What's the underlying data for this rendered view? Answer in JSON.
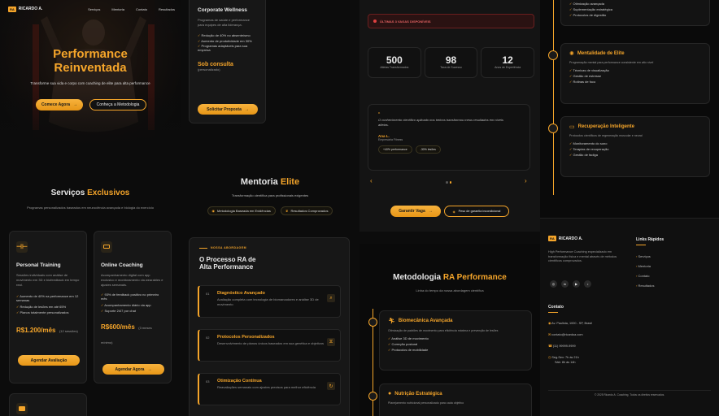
{
  "nav": {
    "logo_badge": "RA",
    "brand": "RICARDO A.",
    "items": [
      "Serviços",
      "Mentoria",
      "Contato",
      "Resultados"
    ]
  },
  "hero": {
    "title_line1": "Performance",
    "title_line2": "Reinventada",
    "subtitle": "Transforme sua vida e corpo com coaching de elite para alta performance",
    "cta_primary": "Comece Agora",
    "cta_secondary": "Conheça a Metodologia"
  },
  "services": {
    "title_a": "Serviços",
    "title_b": "Exclusivos",
    "subtitle": "Programas personalizados baseados em neurociência avançada e biologia do exercício",
    "cards": [
      {
        "title": "Personal Training",
        "desc": "Sessões individuais com análise de movimento em 3D e biofeedback em tempo real.",
        "features": [
          "Aumento de 40% na performance em 12 semanas",
          "Redução de lesões em até 65%",
          "Planos totalmente personalizados"
        ],
        "price": "R$1.200/mês",
        "price_note": "(12 sessões)",
        "cta": "Agendar Avaliação"
      },
      {
        "title": "Online Coaching",
        "desc": "Acompanhamento digital com app exclusivo e monitoramento via wearables e ajustes semanais.",
        "features": [
          "93% de feedback positivo no primeiro mês",
          "Acompanhamento diário via app",
          "Suporte 24/7 por chat"
        ],
        "price": "R$600/mês",
        "price_note": "(3 meses mínimo)",
        "cta": "Agendar Agora"
      }
    ]
  },
  "corporate": {
    "title": "Corporate Wellness",
    "desc": "Programas de saúde e performance para equipes de alta liderança.",
    "features": [
      "Redução de 40% no absenteísmo",
      "Aumento de produtividade em 30%",
      "Programas adaptáveis para sua empresa"
    ],
    "consult_label": "Sob consulta",
    "consult_sub": "(personalizado)",
    "cta": "Solicitar Proposta"
  },
  "mentoria": {
    "title_a": "Mentoria",
    "title_b": "Elite",
    "subtitle": "Transformação científica para profissionais exigentes",
    "badges": [
      "Metodologia Baseada em Evidências",
      "Resultados Comprovados"
    ],
    "section_tag": "NOSSA ABORDAGEM",
    "process_title_line1": "O Processo RA de",
    "process_title_line2": "Alta Performance",
    "steps": [
      {
        "num": "01",
        "title": "Diagnóstico Avançado",
        "desc": "Avaliação completa com tecnologia de biomarcadores e análise 3D de movimento"
      },
      {
        "num": "02",
        "title": "Protocolos Personalizados",
        "desc": "Desenvolvimento de planos únicos baseados em sua genética e objetivos"
      },
      {
        "num": "03",
        "title": "Otimização Contínua",
        "desc": "Reavaliações semanais com ajustes precisos para melhor eficiência"
      }
    ]
  },
  "results": {
    "alert": "ÚLTIMAS 3 VAGAS DISPONÍVEIS",
    "stats": [
      {
        "value": "500",
        "label": "Atletas Transformados"
      },
      {
        "value": "98",
        "label": "Taxa de Sucesso"
      },
      {
        "value": "12",
        "label": "Anos de Experiência"
      }
    ],
    "quote": "O conhecimento científico aplicado nos treinos transformou meus resultados em níveis atletas.",
    "author": "Ana L.",
    "author_role": "Empresária Fitness",
    "tags": [
      "+40% performance",
      "-30% lesões"
    ],
    "cta_primary": "Garantir Vaga",
    "cta_secondary": "Peso de garantia incondicional",
    "arrow_prev": "‹",
    "arrow_next": "›"
  },
  "metodologia": {
    "title_a": "Metodologia",
    "title_b": "RA Performance",
    "subtitle": "Linha do tempo da nossa abordagem científica",
    "items": [
      {
        "title": "Biomecânica Avançada",
        "desc": "Otimização de padrões de movimento para eficiência máxima e prevenção de lesões",
        "features": [
          "Análise 3D de movimento",
          "Correção postural",
          "Protocolos de mobilidade"
        ]
      },
      {
        "title": "Nutrição Estratégica",
        "desc": "Planejamento nutricional personalizado para cada objetivo",
        "features": []
      }
    ]
  },
  "timeline_right": {
    "top_features": [
      "Otimização avançada",
      "Suplementação estratégica",
      "Protocolos de digestão"
    ],
    "items": [
      {
        "title": "Mentalidade de Elite",
        "desc": "Programação mental para performance consistente em alto nível",
        "features": [
          "Técnicas de visualização",
          "Gestão de estresse",
          "Rotinas de foco"
        ]
      },
      {
        "title": "Recuperação Inteligente",
        "desc": "Protocolos científicos de regeneração muscular e neural",
        "features": [
          "Monitoramento do sono",
          "Terapias de recuperação",
          "Gestão de fadiga"
        ]
      }
    ]
  },
  "footer": {
    "brand": "RICARDO A.",
    "logo_badge": "RA",
    "about": "High Performance Coaching especializado em transformação física e mental através de métodos científicos comprovados.",
    "links_title": "Links Rápidos",
    "links": [
      "Serviços",
      "Mentoria",
      "Contato",
      "Resultados"
    ],
    "contact_title": "Contato",
    "address": "Av. Paulista, 1000 - SP, Brasil",
    "email": "contato@ricardoa.com",
    "phone": "(11) 99999-9999",
    "hours_line1": "Seg-Sex: 7h às 21h",
    "hours_line2": "Sáb: 8h às 14h",
    "copyright": "© 2025 Ricardo A. Coaching. Todos os direitos reservados."
  }
}
